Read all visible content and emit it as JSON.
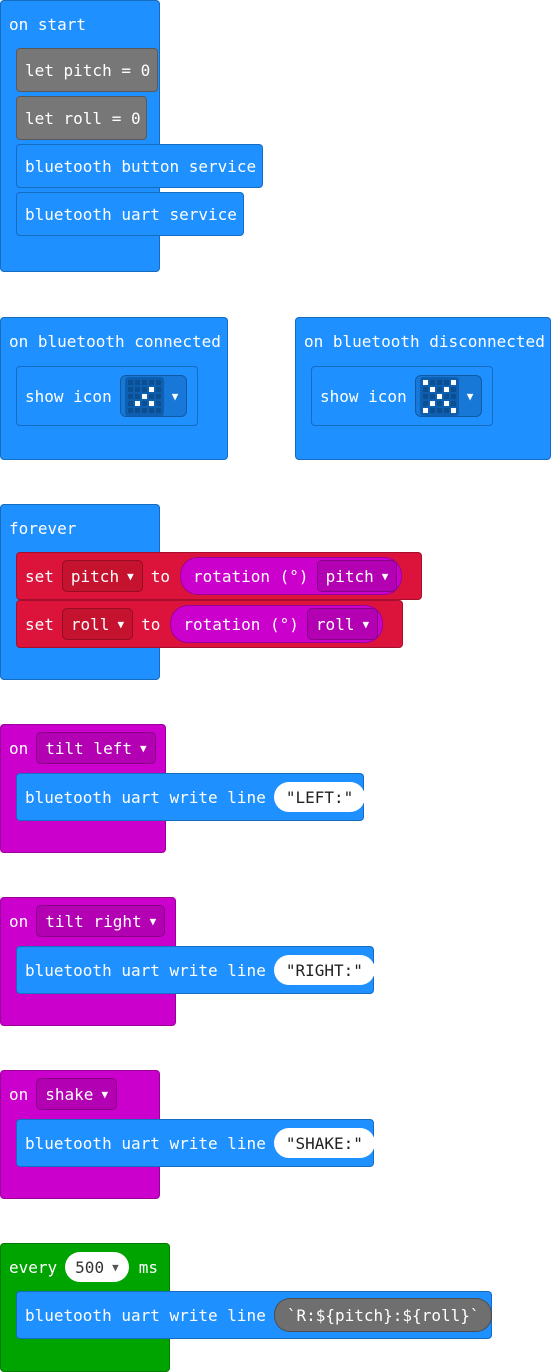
{
  "on_start": {
    "title": "on start",
    "let_pitch": "let pitch = 0",
    "let_roll": "let roll = 0",
    "button_service": "bluetooth button service",
    "uart_service": "bluetooth uart service"
  },
  "on_connected": {
    "title": "on bluetooth connected",
    "show_icon": "show icon",
    "icon_name": "small-diamond-icon",
    "icon_pixels": [
      0,
      0,
      0,
      0,
      0,
      0,
      0,
      0,
      1,
      0,
      0,
      0,
      1,
      0,
      0,
      0,
      1,
      0,
      1,
      0,
      0,
      0,
      0,
      0,
      0
    ]
  },
  "on_disconnected": {
    "title": "on bluetooth disconnected",
    "show_icon": "show icon",
    "icon_name": "x-cross-icon",
    "icon_pixels": [
      1,
      0,
      0,
      0,
      1,
      0,
      1,
      0,
      1,
      0,
      0,
      0,
      1,
      0,
      0,
      0,
      1,
      0,
      1,
      0,
      1,
      0,
      0,
      0,
      1
    ]
  },
  "forever": {
    "title": "forever",
    "set1": {
      "set": "set",
      "var": "pitch",
      "to": "to",
      "rotation": "rotation (°)",
      "axis": "pitch"
    },
    "set2": {
      "set": "set",
      "var": "roll",
      "to": "to",
      "rotation": "rotation (°)",
      "axis": "roll"
    }
  },
  "tilt_left": {
    "on": "on",
    "gesture": "tilt left",
    "write": "bluetooth uart write line",
    "value": "\"LEFT:\""
  },
  "tilt_right": {
    "on": "on",
    "gesture": "tilt right",
    "write": "bluetooth uart write line",
    "value": "\"RIGHT:\""
  },
  "shake": {
    "on": "on",
    "gesture": "shake",
    "write": "bluetooth uart write line",
    "value": "\"SHAKE:\""
  },
  "every": {
    "every": "every",
    "interval": "500",
    "ms": "ms",
    "write": "bluetooth uart write line",
    "value": "`R:${pitch}:${roll}`"
  },
  "colors": {
    "bluetooth": "#1e90ff",
    "variables": "#777777",
    "math_set": "#dc143c",
    "input": "#cc00cc",
    "loops": "#00a400"
  }
}
